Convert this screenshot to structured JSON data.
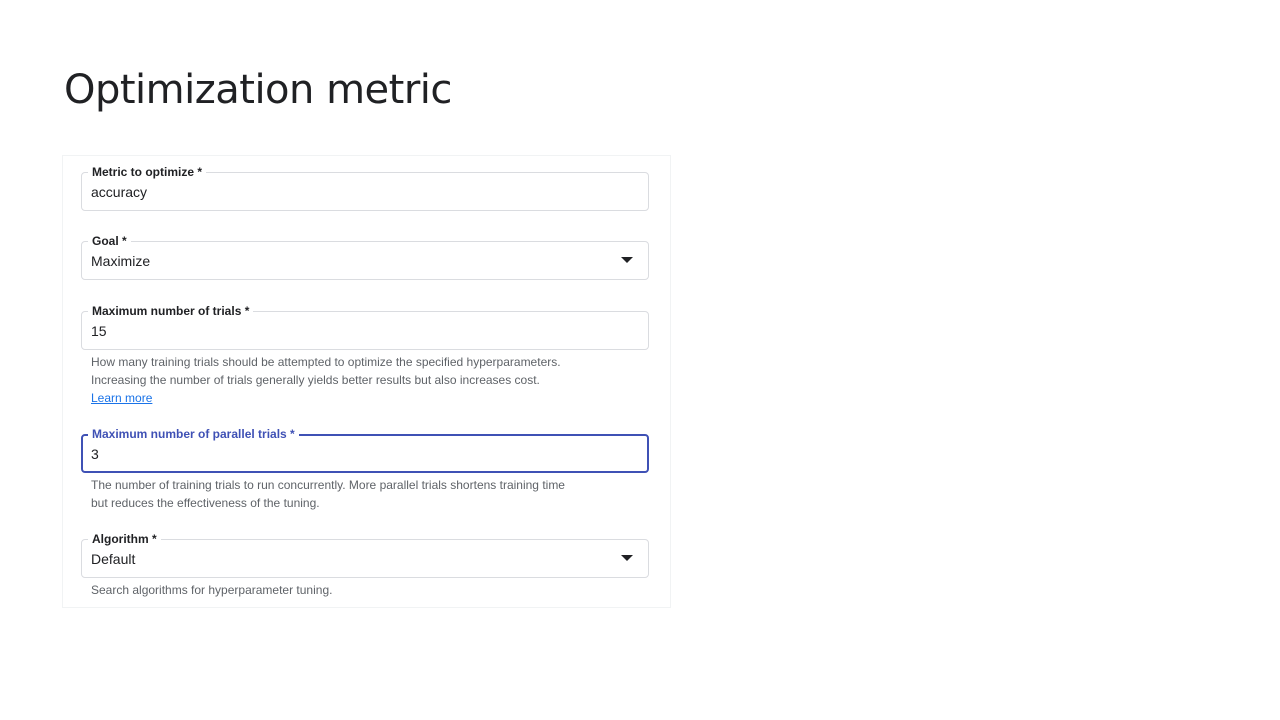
{
  "page": {
    "title": "Optimization metric"
  },
  "form": {
    "metric": {
      "label": "Metric to optimize *",
      "value": "accuracy"
    },
    "goal": {
      "label": "Goal *",
      "value": "Maximize"
    },
    "max_trials": {
      "label": "Maximum number of trials *",
      "value": "15",
      "hint_line1": "How many training trials should be attempted to optimize the specified hyperparameters.",
      "hint_line2": "Increasing the number of trials generally yields better results but also increases cost.",
      "learn_more": "Learn more"
    },
    "max_parallel_trials": {
      "label": "Maximum number of parallel trials *",
      "value": "3",
      "hint_line1": "The number of training trials to run concurrently. More parallel trials shortens training time",
      "hint_line2": "but reduces the effectiveness of the tuning."
    },
    "algorithm": {
      "label": "Algorithm *",
      "value": "Default",
      "hint": "Search algorithms for hyperparameter tuning."
    }
  },
  "colors": {
    "focus_accent": "#3f51b5",
    "link": "#1a73e8",
    "border": "#dadce0",
    "text": "#202124",
    "hint_text": "#5f6368"
  },
  "icons": {
    "dropdown": "arrow-drop-down-icon"
  }
}
